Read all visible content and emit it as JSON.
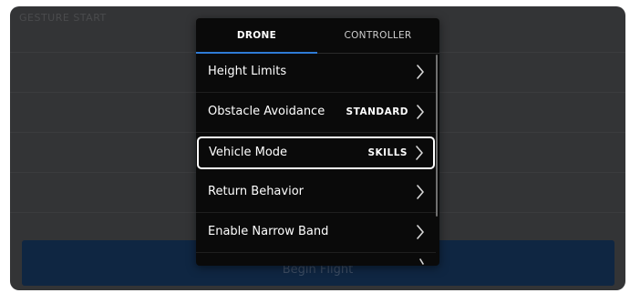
{
  "background": {
    "title": "GESTURE START",
    "begin_label": "Begin Flight"
  },
  "tabs": [
    {
      "label": "DRONE",
      "active": true
    },
    {
      "label": "CONTROLLER",
      "active": false
    }
  ],
  "settings": [
    {
      "label": "Height Limits",
      "value": ""
    },
    {
      "label": "Obstacle Avoidance",
      "value": "STANDARD"
    },
    {
      "label": "Vehicle Mode",
      "value": "SKILLS",
      "selected": true
    },
    {
      "label": "Return Behavior",
      "value": ""
    },
    {
      "label": "Enable Narrow Band",
      "value": ""
    }
  ],
  "colors": {
    "accent": "#2e7bd6",
    "panel": "#0a0a0a",
    "backdrop": "#333436",
    "begin_bar": "#0f2642"
  },
  "icons": {
    "row_arrow": "chevron-right-icon"
  }
}
